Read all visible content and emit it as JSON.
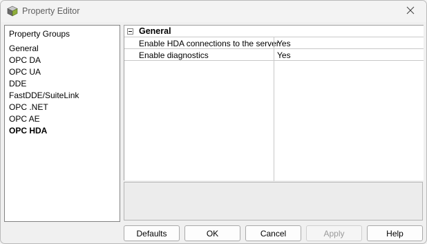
{
  "window": {
    "title": "Property Editor"
  },
  "left_panel": {
    "header": "Property Groups",
    "items": [
      {
        "label": "General",
        "selected": false
      },
      {
        "label": "OPC DA",
        "selected": false
      },
      {
        "label": "OPC UA",
        "selected": false
      },
      {
        "label": "DDE",
        "selected": false
      },
      {
        "label": "FastDDE/SuiteLink",
        "selected": false
      },
      {
        "label": "OPC .NET",
        "selected": false
      },
      {
        "label": "OPC AE",
        "selected": false
      },
      {
        "label": "OPC HDA",
        "selected": true
      }
    ]
  },
  "property_grid": {
    "section_title": "General",
    "rows": [
      {
        "name": "Enable HDA connections to the server",
        "value": "Yes"
      },
      {
        "name": "Enable diagnostics",
        "value": "Yes"
      }
    ]
  },
  "buttons": {
    "defaults": "Defaults",
    "ok": "OK",
    "cancel": "Cancel",
    "apply": "Apply",
    "help": "Help"
  },
  "icons": {
    "app": "property-editor-icon",
    "close": "close-icon",
    "collapse": "collapse-icon"
  }
}
